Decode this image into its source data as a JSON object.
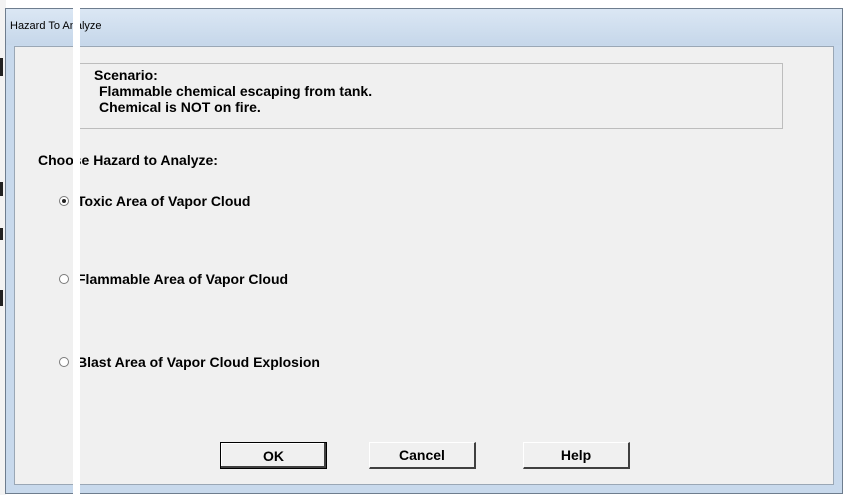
{
  "window": {
    "title": "Hazard To Analyze"
  },
  "scenario": {
    "heading": "Scenario:",
    "line1": "Flammable chemical escaping from tank.",
    "line2": "Chemical is NOT on fire."
  },
  "prompt": "Choose Hazard to Analyze:",
  "options": [
    {
      "label": "Toxic Area of Vapor Cloud",
      "selected": true
    },
    {
      "label": "Flammable Area of Vapor Cloud",
      "selected": false
    },
    {
      "label": "Blast Area of Vapor Cloud Explosion",
      "selected": false
    }
  ],
  "buttons": {
    "ok": "OK",
    "cancel": "Cancel",
    "help": "Help"
  }
}
